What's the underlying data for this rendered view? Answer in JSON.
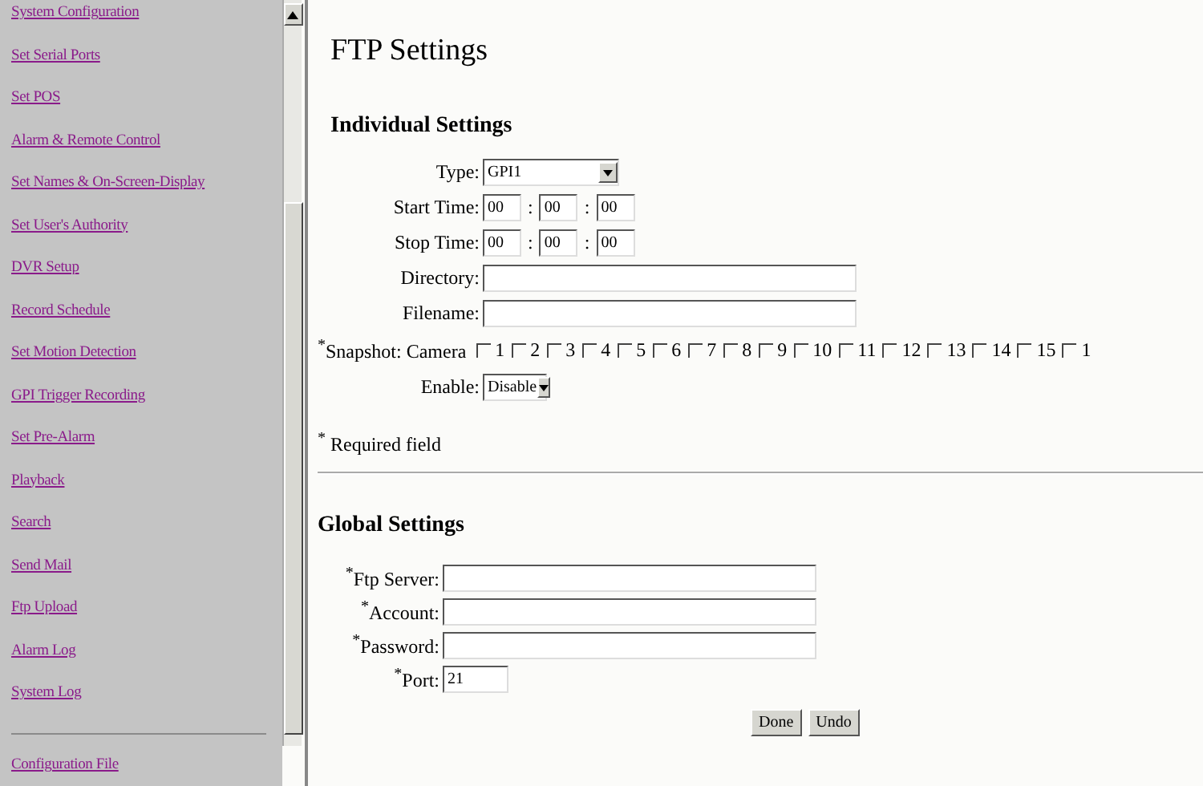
{
  "sidebar": {
    "items": [
      {
        "label": "System Configuration"
      },
      {
        "label": "Set Serial Ports"
      },
      {
        "label": "Set POS"
      },
      {
        "label": "Alarm & Remote Control"
      },
      {
        "label": "Set Names & On-Screen-Display"
      },
      {
        "label": "Set User's Authority"
      },
      {
        "label": "DVR Setup"
      },
      {
        "label": "Record Schedule"
      },
      {
        "label": "Set Motion Detection"
      },
      {
        "label": "GPI Trigger Recording"
      },
      {
        "label": "Set Pre-Alarm"
      },
      {
        "label": "Playback"
      },
      {
        "label": "Search"
      },
      {
        "label": "Send Mail"
      },
      {
        "label": "Ftp Upload"
      },
      {
        "label": "Alarm Log"
      },
      {
        "label": "System Log"
      }
    ],
    "footer_link": "Configuration File"
  },
  "title": "FTP Settings",
  "individual": {
    "heading": "Individual Settings",
    "type": {
      "label": "Type:",
      "value": "GPI1"
    },
    "start_time": {
      "label": "Start Time:",
      "values": [
        "00",
        "00",
        "00"
      ],
      "separator": ":"
    },
    "stop_time": {
      "label": "Stop Time:",
      "values": [
        "00",
        "00",
        "00"
      ],
      "separator": ":"
    },
    "directory": {
      "label": "Directory:"
    },
    "filename": {
      "label": "Filename:"
    },
    "snapshot": {
      "label": "$^{*}$Snapshot: Camera",
      "cameras": [
        {
          "label": "1",
          "checked": false
        },
        {
          "label": "2",
          "checked": false
        },
        {
          "label": "3",
          "checked": false
        },
        {
          "label": "4",
          "checked": false
        },
        {
          "label": "5",
          "checked": false
        },
        {
          "label": "6",
          "checked": false
        },
        {
          "label": "7",
          "checked": false
        },
        {
          "label": "8",
          "checked": false
        },
        {
          "label": "9",
          "checked": false
        },
        {
          "label": "10",
          "checked": false
        },
        {
          "label": "11",
          "checked": false
        },
        {
          "label": "12",
          "checked": false
        },
        {
          "label": "13",
          "checked": false
        },
        {
          "label": "14",
          "checked": false
        },
        {
          "label": "15",
          "checked": false
        },
        {
          "label": "1",
          "checked": false
        }
      ]
    },
    "enable": {
      "label": "Enable:",
      "value": "Disable"
    }
  },
  "required_note": "$^{*}$ Required field",
  "global": {
    "heading": "Global Settings",
    "fields": [
      {
        "label": "$^{*}$Ftp Server:",
        "kind": "text"
      },
      {
        "label": "$^{*}$Account:",
        "kind": "text"
      },
      {
        "label": "$^{*}$Password:",
        "kind": "password"
      },
      {
        "label": "$^{*}$Port:",
        "kind": "short",
        "value": "21"
      }
    ]
  },
  "buttons": [
    "Done",
    "Undo"
  ]
}
